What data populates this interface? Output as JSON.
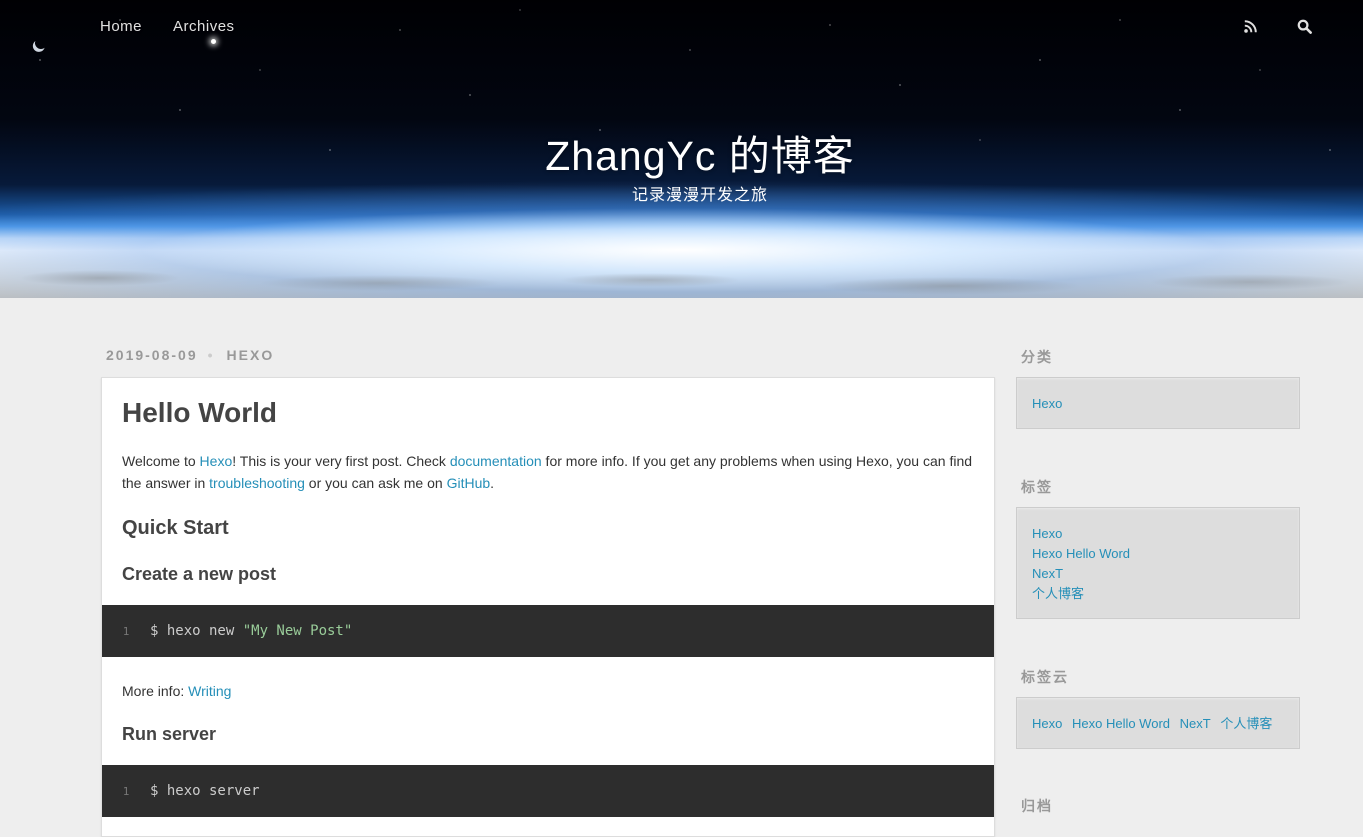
{
  "nav": {
    "links": [
      "Home",
      "Archives"
    ],
    "icons": [
      "rss-icon",
      "search-icon"
    ]
  },
  "header": {
    "title": "ZhangYc 的博客",
    "subtitle": "记录漫漫开发之旅"
  },
  "article": {
    "date": "2019-08-09",
    "category": "HEXO",
    "title": "Hello World",
    "intro": {
      "p1": "Welcome to ",
      "link1": "Hexo",
      "p2": "! This is your very first post. Check ",
      "link2": "documentation",
      "p3": " for more info. If you get any problems when using Hexo, you can find the answer in ",
      "link3": "troubleshooting",
      "p4": " or you can ask me on ",
      "link4": "GitHub",
      "p5": "."
    },
    "quick_start": "Quick Start",
    "create_post": "Create a new post",
    "code1": {
      "line": "1",
      "cmd": "$ hexo new ",
      "str": "\"My New Post\""
    },
    "more_info_label": "More info: ",
    "more_info_link": "Writing",
    "run_server": "Run server",
    "code2": {
      "line": "1",
      "cmd": "$ hexo server"
    }
  },
  "sidebar": {
    "categories": {
      "title": "分类",
      "items": [
        "Hexo"
      ]
    },
    "tags": {
      "title": "标签",
      "items": [
        "Hexo",
        "Hexo Hello Word",
        "NexT",
        "个人博客"
      ]
    },
    "tagcloud": {
      "title": "标签云",
      "items": [
        "Hexo",
        "Hexo Hello Word",
        "NexT",
        "个人博客"
      ]
    },
    "archives": {
      "title": "归档"
    }
  }
}
